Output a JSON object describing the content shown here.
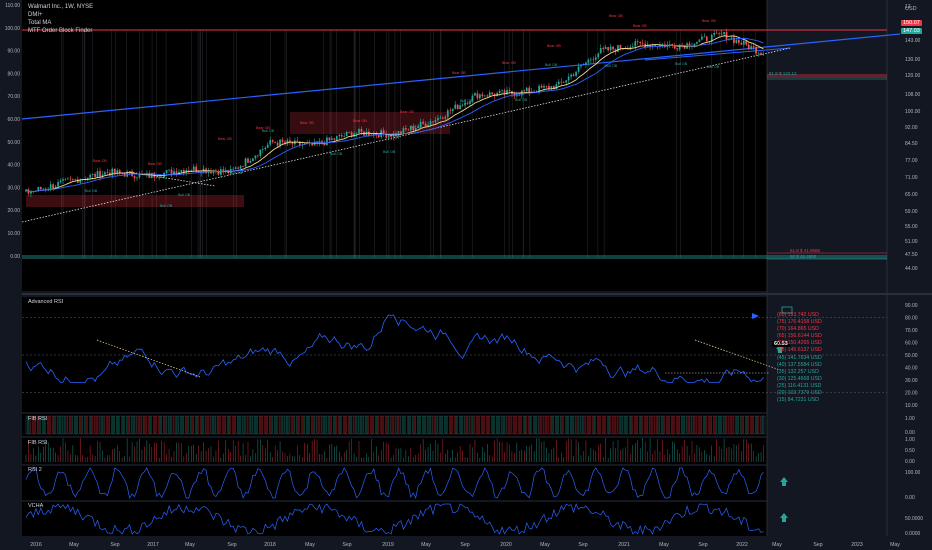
{
  "legend": {
    "title": "Walmart Inc., 1W, NYSE",
    "lines": [
      "DMI+",
      "Total MA",
      "MTF Order Block Finder"
    ]
  },
  "left_axis_labels": [
    "110.00",
    "100.00",
    "90.00",
    "80.00",
    "70.00",
    "60.00",
    "50.00",
    "40.00",
    "30.00",
    "20.00",
    "10.00",
    "0.00"
  ],
  "right_axis": {
    "currency": "USD",
    "labels": [
      "17",
      "143.00",
      "130.00",
      "120.00",
      "108.00",
      "100.00",
      "92.00",
      "84.50",
      "77.00",
      "71.00",
      "65.00",
      "59.00",
      "55.00",
      "51.00",
      "47.50",
      "44.00"
    ],
    "price_tag": "150.07",
    "price_tag2": "147.03",
    "price_color": "#f23645"
  },
  "rsi_axis_labels": [
    "90.00",
    "80.00",
    "70.00",
    "60.00",
    "50.00",
    "40.00",
    "30.00",
    "20.00",
    "10.00"
  ],
  "rsi_current": "60.53",
  "rsi_table": [
    {
      "level": "(80)",
      "value": "193.742 USD",
      "color": "#f23645"
    },
    {
      "level": "(75)",
      "value": "176.4158 USD",
      "color": "#f23645"
    },
    {
      "level": "(70)",
      "value": "164.865 USD",
      "color": "#f23645"
    },
    {
      "level": "(65)",
      "value": "156.6144 USD",
      "color": "#f23645"
    },
    {
      "level": "(60)",
      "value": "150.4265 USD",
      "color": "#f23645"
    },
    {
      "level": "(55)",
      "value": "145.6137 USD",
      "color": "#f23645"
    },
    {
      "level": "(45)",
      "value": "141.7634 USD",
      "color": "#26a69a"
    },
    {
      "level": "(40)",
      "value": "137.5584 USD",
      "color": "#26a69a"
    },
    {
      "level": "(35)",
      "value": "132.257 USD",
      "color": "#26a69a"
    },
    {
      "level": "(30)",
      "value": "125.4668 USD",
      "color": "#26a69a"
    },
    {
      "level": "(25)",
      "value": "116.4131 USD",
      "color": "#26a69a"
    },
    {
      "level": "(20)",
      "value": "103.7379 USD",
      "color": "#26a69a"
    },
    {
      "level": "(15)",
      "value": "84.7231 USD",
      "color": "#26a69a"
    }
  ],
  "panels": {
    "rsi_title": "Advanced RSI",
    "fib1_title": "FIB RSI",
    "fib2_title": "FIB RSI",
    "rsi2_title": "RSI 2",
    "vcha_title": "VCHA",
    "fib1_axis": [
      "1.00",
      "0.00"
    ],
    "fib2_axis": [
      "1.00",
      "0.50",
      "0.00"
    ],
    "rsi2_axis": [
      "100.00",
      "0.00"
    ],
    "vcha_axis": [
      "50.0000",
      "0.0000"
    ]
  },
  "order_block_labels": {
    "bear": "Bear OB",
    "bull": "Bull OB"
  },
  "fib_labels": [
    "61.8 $ 122.12",
    "61.8 $ 41.9685",
    "50 $ 46.4990"
  ],
  "time_axis": [
    "2016",
    "May",
    "Sep",
    "2017",
    "May",
    "Sep",
    "2018",
    "May",
    "Sep",
    "2019",
    "May",
    "Sep",
    "2020",
    "May",
    "Sep",
    "2021",
    "May",
    "Sep",
    "2022",
    "May",
    "Sep",
    "2023",
    "May"
  ],
  "chart_data": {
    "type": "line",
    "title": "Walmart Inc., 1W, NYSE",
    "x": [
      "2016",
      "May",
      "Sep",
      "2017",
      "May",
      "Sep",
      "2018",
      "May",
      "Sep",
      "2019",
      "May",
      "Sep",
      "2020",
      "May",
      "Sep",
      "2021",
      "May",
      "Sep",
      "2022"
    ],
    "series": [
      {
        "name": "Walmart Inc.",
        "values": [
          61,
          67,
          72,
          70,
          74,
          72,
          88,
          86,
          93,
          92,
          100,
          113,
          114,
          118,
          136,
          140,
          139,
          145,
          135
        ]
      }
    ],
    "ylim": [
      44,
      150
    ],
    "grid": true,
    "legend": "top-left"
  }
}
